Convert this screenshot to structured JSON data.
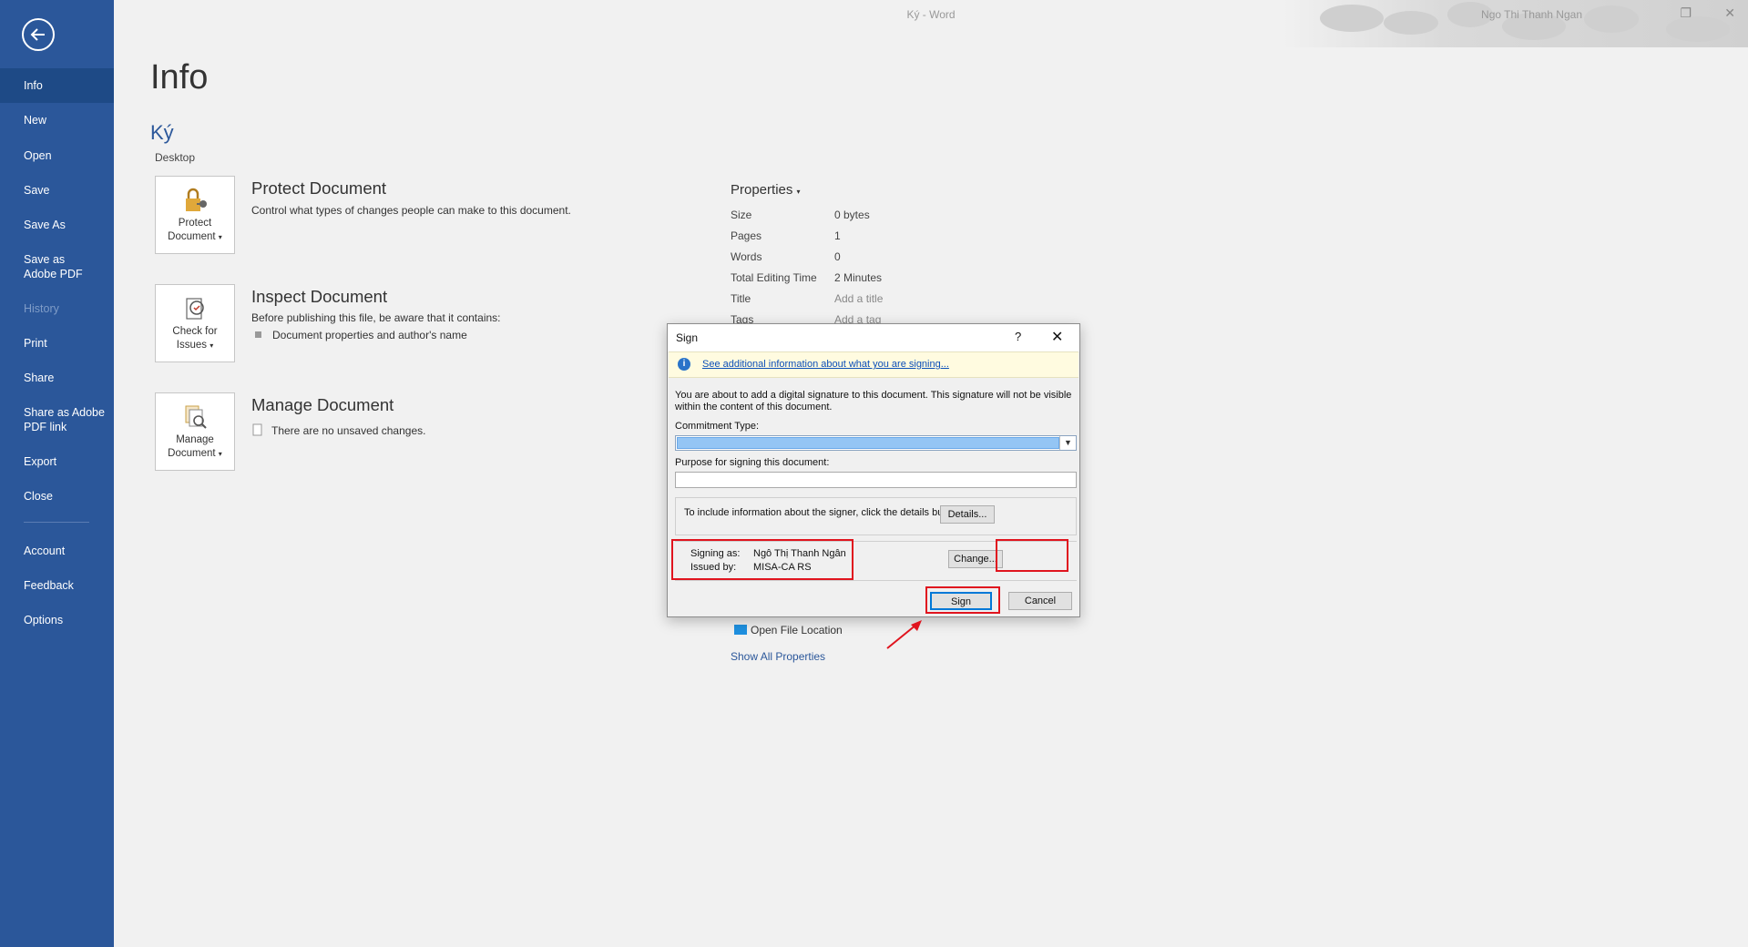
{
  "window": {
    "title": "Ký  -  Word",
    "user": "Ngo Thi Thanh Ngan",
    "restore_glyph": "❐",
    "close_glyph": "✕"
  },
  "nav": {
    "back_icon": "back-arrow-icon",
    "items": [
      {
        "label": "Info",
        "state": "active"
      },
      {
        "label": "New"
      },
      {
        "label": "Open"
      },
      {
        "label": "Save"
      },
      {
        "label": "Save As"
      },
      {
        "label": "Save as Adobe PDF"
      },
      {
        "label": "History",
        "state": "disabled"
      },
      {
        "label": "Print"
      },
      {
        "label": "Share"
      },
      {
        "label": "Share as Adobe PDF link"
      },
      {
        "label": "Export"
      },
      {
        "label": "Close"
      },
      {
        "label": "Account"
      },
      {
        "label": "Feedback"
      },
      {
        "label": "Options"
      }
    ]
  },
  "main": {
    "title": "Info",
    "doc_name": "Ký",
    "doc_location": "Desktop",
    "sections": [
      {
        "tile_label_1": "Protect",
        "tile_label_2": "Document",
        "title": "Protect Document",
        "desc": "Control what types of changes people can make to this document.",
        "icon": "lock-key-icon"
      },
      {
        "tile_label_1": "Check for",
        "tile_label_2": "Issues",
        "title": "Inspect Document",
        "desc": "Before publishing this file, be aware that it contains:",
        "bullet": "Document properties and author's name",
        "icon": "inspect-document-icon"
      },
      {
        "tile_label_1": "Manage",
        "tile_label_2": "Document",
        "title": "Manage Document",
        "desc": "There are no unsaved changes.",
        "icon": "manage-document-icon"
      }
    ],
    "caret": "▾"
  },
  "properties": {
    "title": "Properties",
    "rows": [
      {
        "label": "Size",
        "value": "0 bytes"
      },
      {
        "label": "Pages",
        "value": "1"
      },
      {
        "label": "Words",
        "value": "0"
      },
      {
        "label": "Total Editing Time",
        "value": "2 Minutes"
      },
      {
        "label": "Title",
        "value": "Add a title"
      },
      {
        "label": "Tags",
        "value": "Add a tag"
      }
    ],
    "open_file_location": "Open File Location",
    "show_all": "Show All Properties"
  },
  "dialog": {
    "title": "Sign",
    "help": "?",
    "close": "✕",
    "info_link": "See additional information about what you are signing...",
    "message": "You are about to add a digital signature to this document. This signature will not be visible within the content of this document.",
    "commitment_label": "Commitment Type:",
    "commitment_value": "",
    "purpose_label": "Purpose for signing this document:",
    "purpose_value": "",
    "details_text": "To include information about the signer, click the details button.",
    "details_button": "Details...",
    "signing_as_label": "Signing as:",
    "signing_as_value": "Ngô Thị Thanh Ngân",
    "issued_by_label": "Issued by:",
    "issued_by_value": "MISA-CA RS",
    "change_button": "Change...",
    "sign_button": "Sign",
    "cancel_button": "Cancel",
    "highlight_color": "#e0141e"
  }
}
